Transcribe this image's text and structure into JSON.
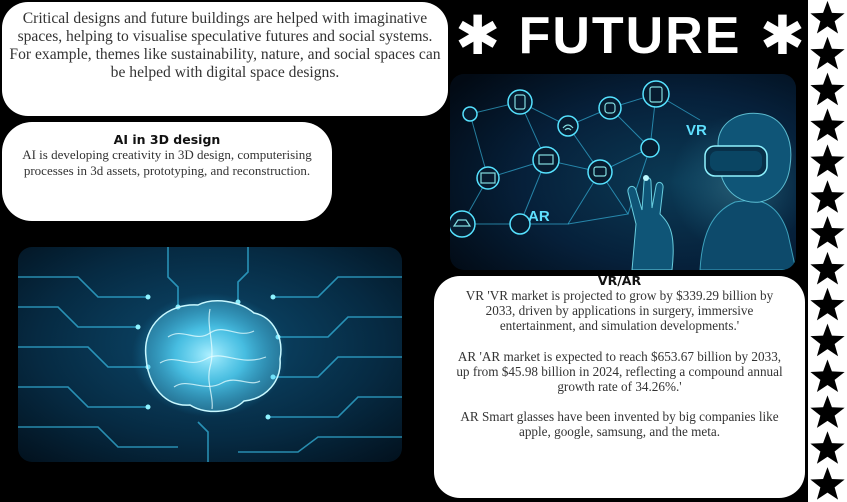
{
  "header": {
    "title": "FUTURE",
    "left_glyph": "✱",
    "right_glyph": "✱"
  },
  "intro_card": {
    "text": "Critical designs and future buildings are helped with imaginative spaces, helping to visualise speculative futures and social systems. For example, themes like sustainability, nature, and social spaces can be helped with digital space designs."
  },
  "ai_card": {
    "heading": "AI in 3D design",
    "text": "AI is developing creativity in 3D design, computerising processes in 3d assets, prototyping, and reconstruction."
  },
  "vr_image": {
    "label_vr": "VR",
    "label_ar": "AR",
    "icons": [
      "phone-icon",
      "wifi-icon",
      "watch-icon",
      "laptop-icon",
      "camera-icon",
      "monitor-icon",
      "car-icon",
      "tablet-icon"
    ]
  },
  "brain_image": {
    "description_icon": "brain-circuit-icon"
  },
  "vrar_card": {
    "heading": "VR/AR",
    "vr_text": "VR 'VR market is projected to grow by $339.29 billion by 2033, driven by applications in surgery, immersive entertainment, and simulation developments.'",
    "ar_text": "AR 'AR market is expected to reach $653.67 billion by 2033, up from $45.98 billion in 2024, reflecting a compound annual growth rate of 34.26%.'",
    "glasses_text": "AR Smart glasses have been invented by big companies like apple, google, samsung, and the meta."
  },
  "colors": {
    "background": "#000000",
    "card": "#ffffff",
    "accent_cyan": "#3fd4ff",
    "deep_blue": "#04121f"
  },
  "star_strip": {
    "star_count": 14
  }
}
